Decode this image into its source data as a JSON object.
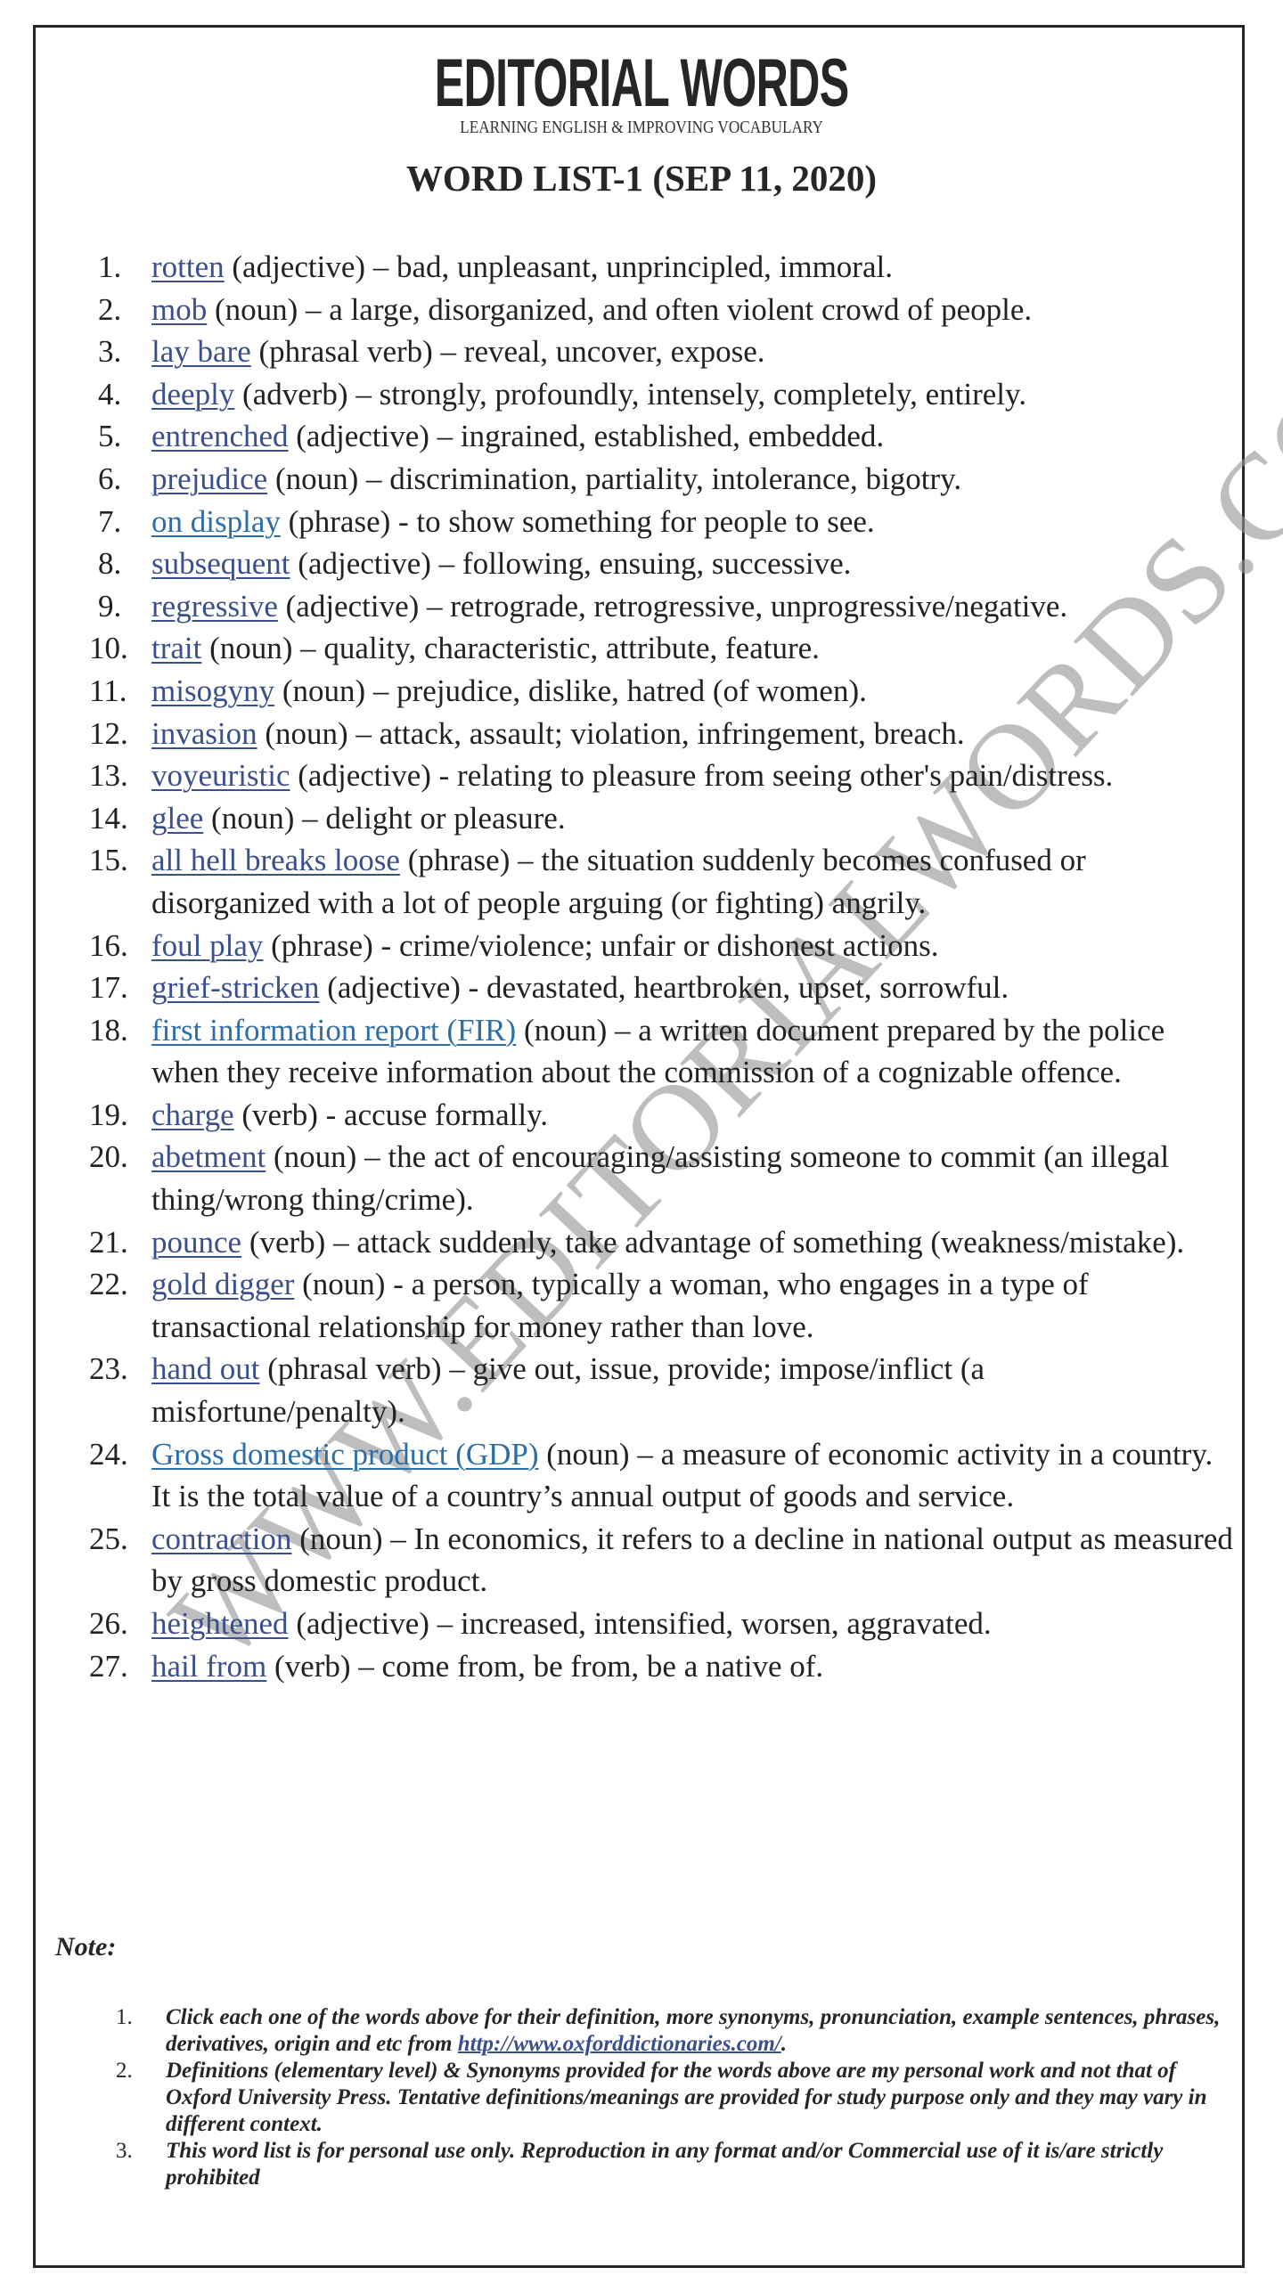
{
  "header": {
    "brand": "EDITORIAL WORDS",
    "tagline": "LEARNING ENGLISH & IMPROVING VOCABULARY",
    "list_title": "WORD LIST-1 (SEP 11, 2020)"
  },
  "watermark": "WWW.EDITORIALWORDS.COM",
  "colors": {
    "link": "#3b4f8c",
    "link_alt": "#2e6ea6",
    "text": "#222222",
    "border": "#262626",
    "watermark": "#969696"
  },
  "words": [
    {
      "num": "1.",
      "term": "rotten",
      "rest": " (adjective) – bad, unpleasant, unprincipled, immoral."
    },
    {
      "num": "2.",
      "term": "mob",
      "rest": " (noun) – a large, disorganized, and often violent crowd of people."
    },
    {
      "num": "3.",
      "term": "lay bare",
      "rest": " (phrasal verb) – reveal, uncover, expose."
    },
    {
      "num": "4.",
      "term": "deeply",
      "rest": " (adverb) – strongly, profoundly, intensely, completely, entirely."
    },
    {
      "num": "5.",
      "term": "entrenched",
      "rest": " (adjective) – ingrained, established, embedded."
    },
    {
      "num": "6.",
      "term": "prejudice",
      "rest": " (noun) – discrimination, partiality, intolerance, bigotry."
    },
    {
      "num": "7.",
      "term": "on display",
      "rest": " (phrase) - to show something for people to see."
    },
    {
      "num": "8.",
      "term": "subsequent",
      "rest": " (adjective) – following, ensuing, successive."
    },
    {
      "num": "9.",
      "term": "regressive",
      "rest": " (adjective) – retrograde, retrogressive, unprogressive/negative."
    },
    {
      "num": "10.",
      "term": "trait",
      "rest": " (noun) – quality, characteristic, attribute, feature."
    },
    {
      "num": "11.",
      "term": "misogyny",
      "rest": " (noun) – prejudice, dislike, hatred (of women)."
    },
    {
      "num": "12.",
      "term": "invasion",
      "rest": " (noun) – attack, assault; violation, infringement, breach."
    },
    {
      "num": "13.",
      "term": "voyeuristic",
      "rest": " (adjective) - relating to pleasure from seeing other's pain/distress."
    },
    {
      "num": "14.",
      "term": "glee",
      "rest": " (noun) – delight or pleasure."
    },
    {
      "num": "15.",
      "term": "all hell breaks loose",
      "rest": " (phrase) – the situation suddenly becomes confused or disorganized with a lot of people arguing (or fighting) angrily."
    },
    {
      "num": "16.",
      "term": "foul play",
      "rest": " (phrase) - crime/violence; unfair or dishonest actions."
    },
    {
      "num": "17.",
      "term": "grief-stricken",
      "rest": " (adjective) - devastated, heartbroken, upset, sorrowful."
    },
    {
      "num": "18.",
      "term": "first information report (FIR)",
      "rest": " (noun) – a written document prepared by the police when they receive information about the commission of a cognizable offence."
    },
    {
      "num": "19.",
      "term": "charge",
      "rest": " (verb) - accuse formally."
    },
    {
      "num": "20.",
      "term": "abetment",
      "rest": " (noun) – the act of encouraging/assisting someone to commit (an illegal thing/wrong thing/crime)."
    },
    {
      "num": "21.",
      "term": "pounce",
      "rest": " (verb) – attack suddenly, take advantage of something (weakness/mistake)."
    },
    {
      "num": "22.",
      "term": "gold digger",
      "rest": " (noun) - a person, typically a woman, who engages in a type of transactional relationship for money rather than love."
    },
    {
      "num": "23.",
      "term": "hand out",
      "rest": " (phrasal verb) – give out, issue, provide; impose/inflict (a misfortune/penalty)."
    },
    {
      "num": "24.",
      "term": "Gross domestic product (GDP)",
      "rest": " (noun) – a measure of economic activity in a country. It is the total value of a country’s annual output of goods and service."
    },
    {
      "num": "25.",
      "term": "contraction",
      "rest": " (noun) – In economics, it refers to a decline in national output as measured by gross domestic product."
    },
    {
      "num": "26.",
      "term": "heightened",
      "rest": " (adjective) – increased, intensified, worsen, aggravated."
    },
    {
      "num": "27.",
      "term": "hail from",
      "rest": " (verb) – come from, be from, be a native of."
    }
  ],
  "note": {
    "label": "Note:",
    "items": [
      {
        "num": "1.",
        "text": "Click each one of the words above for their definition, more synonyms, pronunciation, example sentences, phrases, derivatives, origin and etc from ",
        "link": "http://www.oxforddictionaries.com/",
        "after": "."
      },
      {
        "num": "2.",
        "text": "Definitions (elementary level) & Synonyms provided for the words above are my personal work and not that of Oxford University Press. Tentative definitions/meanings are provided for study purpose only and they may vary in different context."
      },
      {
        "num": "3.",
        "text": "This word list is for personal use only. Reproduction in any format and/or Commercial use of it is/are strictly prohibited"
      }
    ]
  }
}
